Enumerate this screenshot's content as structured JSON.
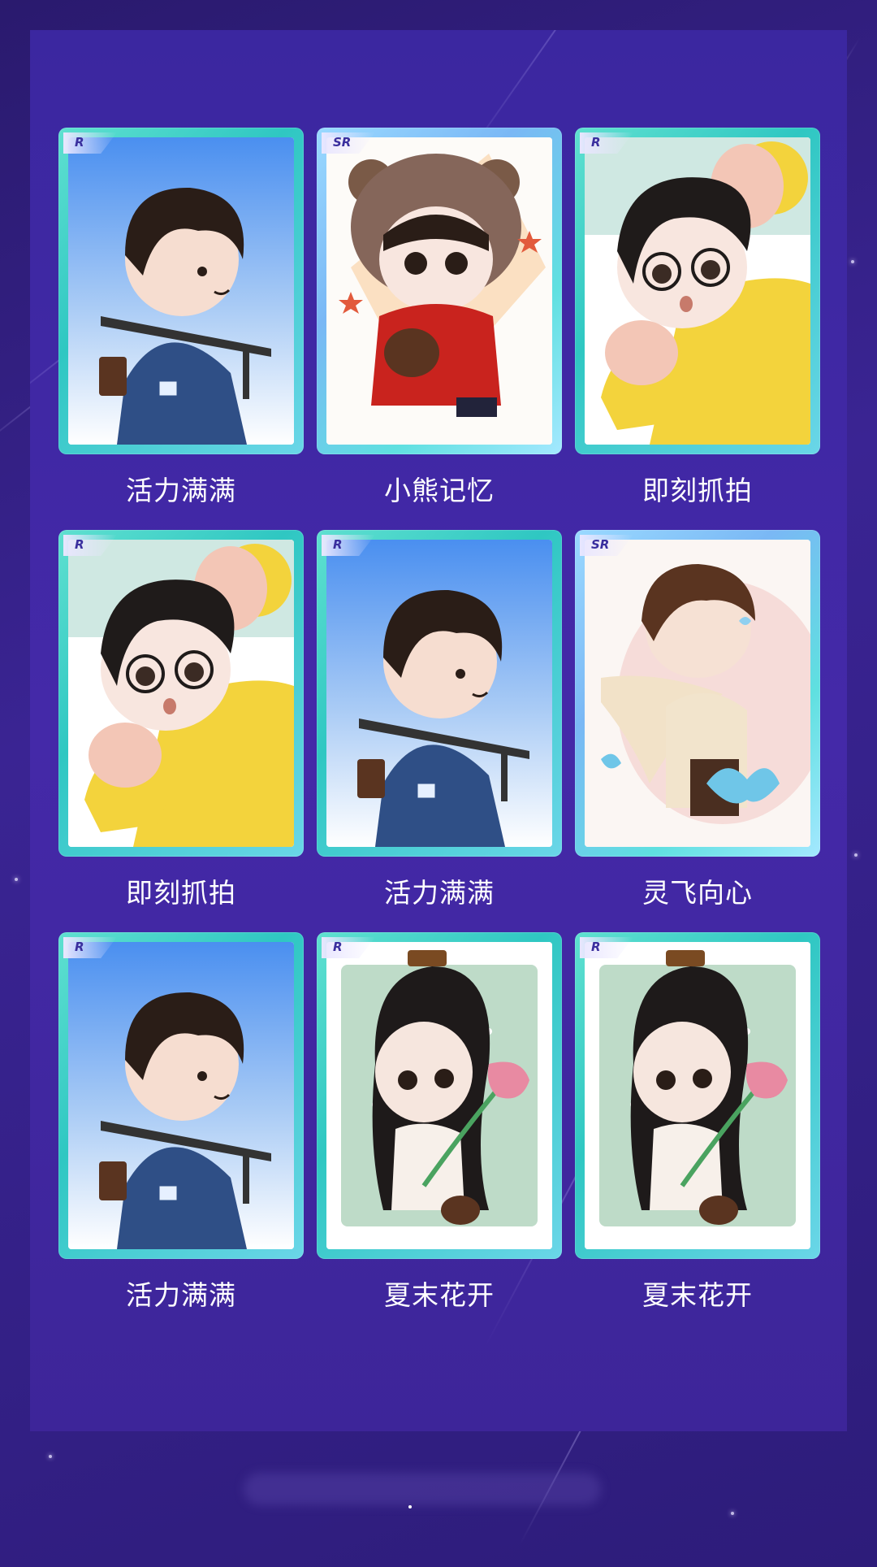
{
  "cards": [
    {
      "rarity": "R",
      "name": "活力满满",
      "art": "office-icon",
      "bg": "sky"
    },
    {
      "rarity": "SR",
      "name": "小熊记忆",
      "art": "bear-icon",
      "bg": "bear"
    },
    {
      "rarity": "R",
      "name": "即刻抓拍",
      "art": "camera-paw-icon",
      "bg": "yellow"
    },
    {
      "rarity": "R",
      "name": "即刻抓拍",
      "art": "camera-paw-icon",
      "bg": "yellow"
    },
    {
      "rarity": "R",
      "name": "活力满满",
      "art": "office-icon",
      "bg": "sky"
    },
    {
      "rarity": "SR",
      "name": "灵飞向心",
      "art": "butterfly-icon",
      "bg": "pink"
    },
    {
      "rarity": "R",
      "name": "活力满满",
      "art": "office-icon",
      "bg": "sky"
    },
    {
      "rarity": "R",
      "name": "夏末花开",
      "art": "lotus-icon",
      "bg": "green"
    },
    {
      "rarity": "R",
      "name": "夏末花开",
      "art": "lotus-icon",
      "bg": "green"
    }
  ],
  "colors": {
    "background": "#2d1c7a",
    "panel": "#4429a8",
    "card_border_r": "#2fc7c2",
    "card_border_sr": "#7ab8f5",
    "label": "#ffffff",
    "badge_text": "#3a2f9e"
  }
}
